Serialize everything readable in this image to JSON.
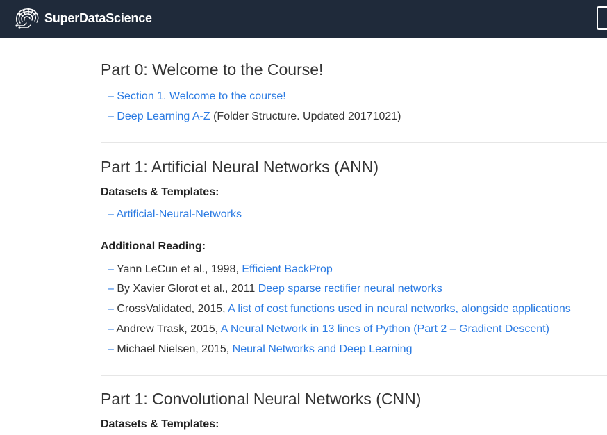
{
  "header": {
    "brand_name": "SuperDataScience"
  },
  "sections": [
    {
      "title": "Part 0: Welcome to the Course!",
      "links": [
        {
          "link": "Section 1. Welcome to the course!",
          "suffix": ""
        },
        {
          "link": "Deep Learning A-Z",
          "suffix": " (Folder Structure. Updated 20171021)"
        }
      ]
    },
    {
      "title": "Part 1: Artificial Neural Networks (ANN)",
      "datasets_heading": "Datasets & Templates:",
      "datasets": [
        {
          "link": "Artificial-Neural-Networks"
        }
      ],
      "reading_heading": "Additional Reading:",
      "reading": [
        {
          "prefix": "Yann LeCun et al., 1998, ",
          "link": "Efficient BackProp"
        },
        {
          "prefix": "By Xavier Glorot et al., 2011 ",
          "link": "Deep sparse rectifier neural networks"
        },
        {
          "prefix": "CrossValidated, 2015, ",
          "link": "A list of cost functions used in neural networks, alongside applications"
        },
        {
          "prefix": "Andrew Trask, 2015, ",
          "link": "A Neural Network in 13 lines of Python (Part 2 – Gradient Descent)"
        },
        {
          "prefix": "Michael Nielsen, 2015, ",
          "link": "Neural Networks and Deep Learning"
        }
      ]
    },
    {
      "title": "Part 1: Convolutional Neural Networks (CNN)",
      "datasets_heading": "Datasets & Templates:"
    }
  ],
  "dash": "– ",
  "colors": {
    "header_bg": "#1f2a3a",
    "link": "#2a7ae2",
    "text": "#333333"
  }
}
